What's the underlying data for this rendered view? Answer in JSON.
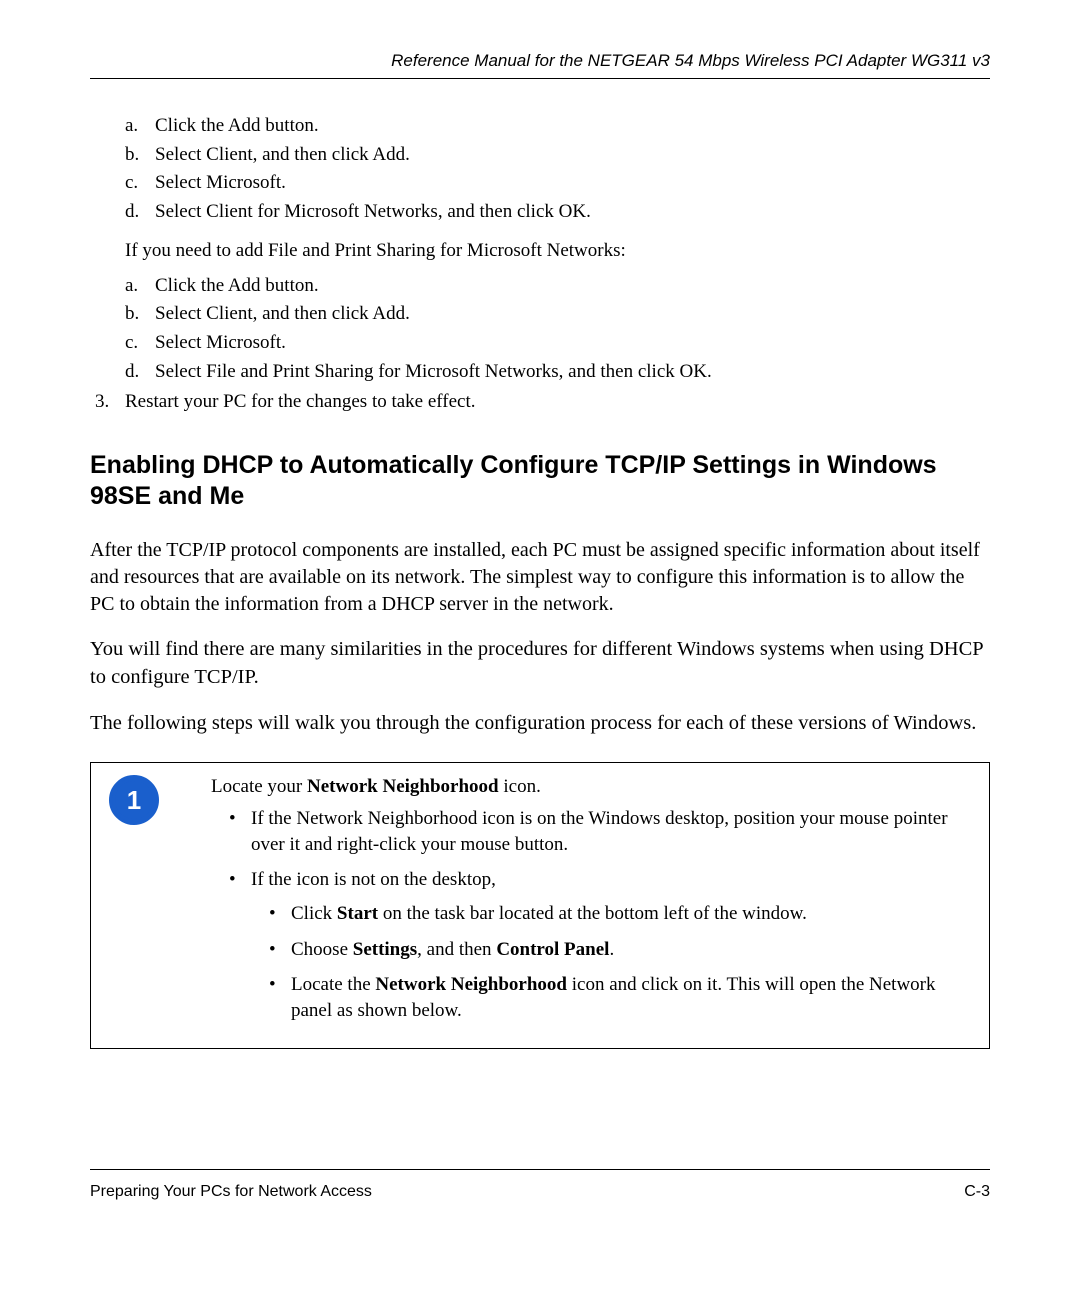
{
  "header": {
    "title": "Reference Manual for the NETGEAR 54 Mbps Wireless PCI Adapter WG311 v3"
  },
  "list1": {
    "a": "Click the Add button.",
    "b": "Select Client, and then click Add.",
    "c": "Select Microsoft.",
    "d": "Select Client for Microsoft Networks, and then click OK."
  },
  "intro1": "If you need to add File and Print Sharing for Microsoft Networks:",
  "list2": {
    "a": "Click the Add button.",
    "b": "Select Client, and then click Add.",
    "c": "Select Microsoft.",
    "d": "Select File and Print Sharing for Microsoft Networks, and then click OK."
  },
  "num3": "Restart your PC for the changes to take effect.",
  "section_heading": "Enabling DHCP to Automatically Configure TCP/IP Settings in Windows 98SE and Me",
  "para1": "After the TCP/IP protocol components are installed, each PC must be assigned specific information about itself and resources that are available on its network. The simplest way to configure this information is to allow the PC to obtain the information from a DHCP server in the network.",
  "para2": "You will find there are many similarities in the procedures for different Windows systems when using DHCP to configure TCP/IP.",
  "para3": "The following steps will walk you through the configuration process for each of these versions of Windows.",
  "step": {
    "badge": "1",
    "intro_pre": "Locate your ",
    "intro_bold": "Network Neighborhood",
    "intro_post": " icon.",
    "b1": "If the Network Neighborhood icon is on the Windows desktop, position your mouse pointer over it and right-click your mouse button.",
    "b2": "If the icon is not on the desktop,",
    "b2a_pre": "Click ",
    "b2a_bold": "Start",
    "b2a_post": " on the task bar located at the bottom left of the window.",
    "b2b_pre": "Choose ",
    "b2b_bold1": "Settings",
    "b2b_mid": ", and then ",
    "b2b_bold2": "Control Panel",
    "b2b_post": ".",
    "b2c_pre": "Locate the ",
    "b2c_bold": "Network Neighborhood",
    "b2c_post": " icon and click on it. This will open the Network panel as shown below."
  },
  "footer": {
    "left": "Preparing Your PCs for Network Access",
    "right": "C-3"
  },
  "markers": {
    "a": "a.",
    "b": "b.",
    "c": "c.",
    "d": "d.",
    "n3": "3."
  }
}
